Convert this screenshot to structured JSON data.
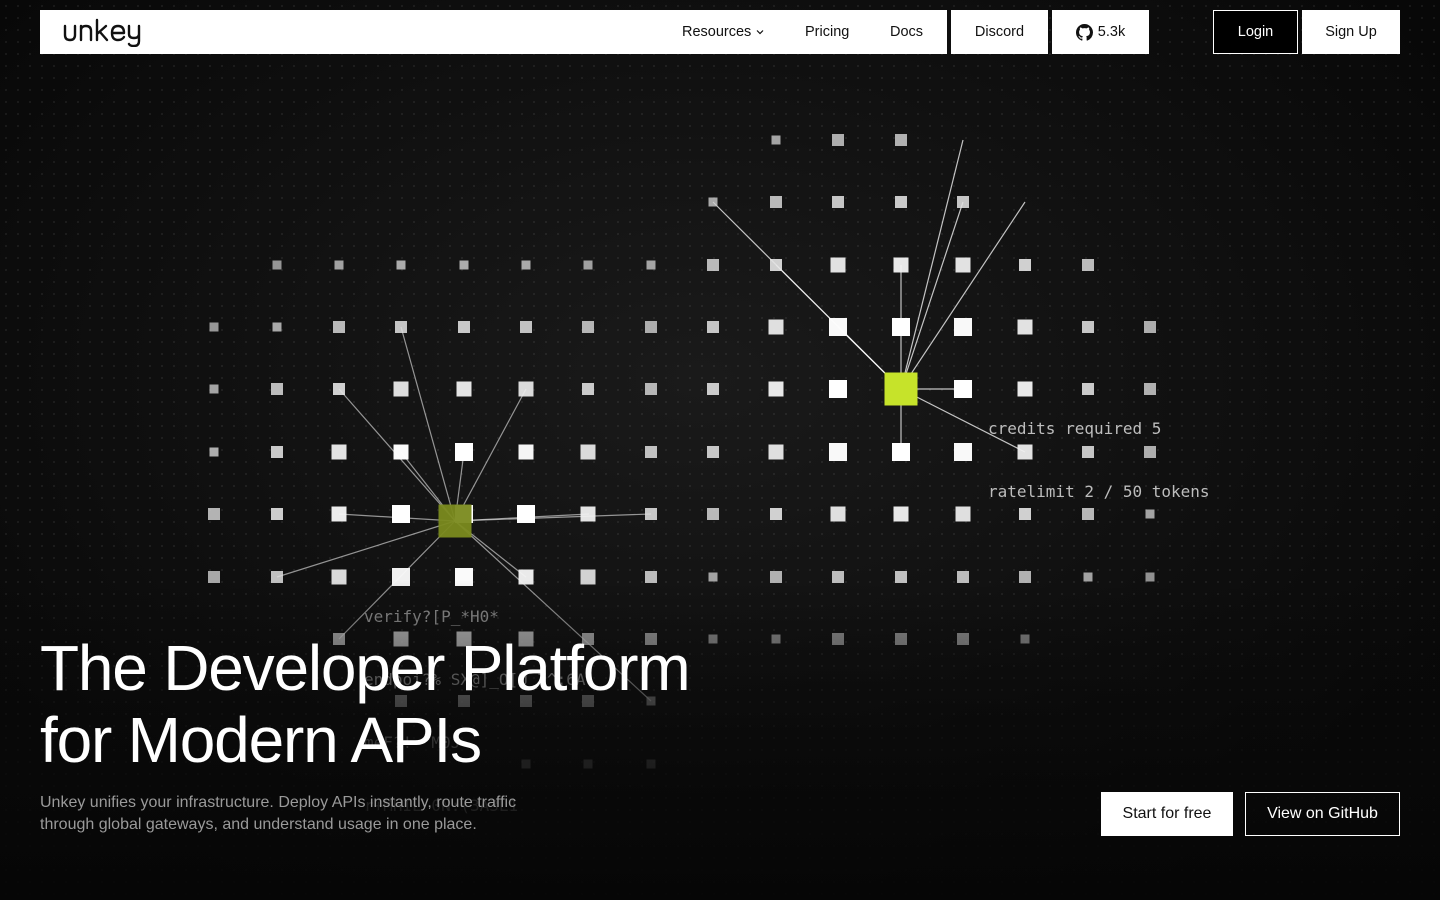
{
  "brand": {
    "logo_text": "unkey"
  },
  "nav": {
    "links": [
      {
        "label": "Resources",
        "has_dropdown": true
      },
      {
        "label": "Pricing"
      },
      {
        "label": "Docs"
      }
    ],
    "discord_label": "Discord",
    "github_stars": "5.3k",
    "login_label": "Login",
    "signup_label": "Sign Up"
  },
  "viz": {
    "accent_color": "#c6e32a",
    "right_node_labels": [
      "credits required 5",
      "ratelimit 2 / 50 tokens"
    ],
    "left_node_labels": [
      "verify?[P_*H0*",
      "endpoi?% SX@]_O[U_7^:6A",
      "meF?!= M0J",
      "r+MHIL 0N:(3A3L1"
    ]
  },
  "hero": {
    "title_line1": "The Developer Platform",
    "title_line2": "for Modern APIs",
    "subtitle_line1": "Unkey unifies your infrastructure. Deploy APIs instantly, route traffic",
    "subtitle_line2": "through global gateways, and understand usage in one place.",
    "primary_cta": "Start for free",
    "secondary_cta": "View on GitHub"
  }
}
